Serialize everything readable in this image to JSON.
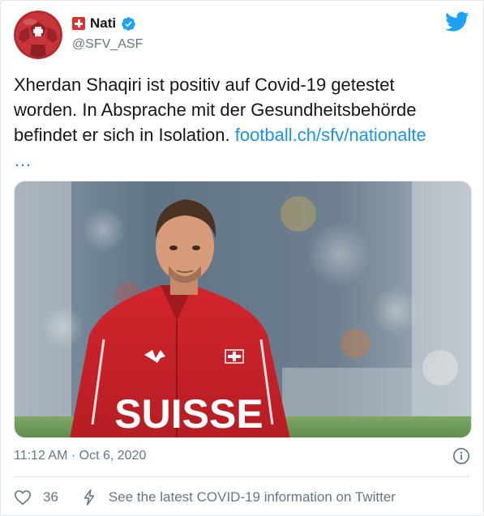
{
  "account": {
    "display_name": "Nati",
    "handle": "@SFV_ASF"
  },
  "tweet": {
    "text_lines": [
      "Xherdan Shaqiri ist positiv auf Covid-19 getestet",
      "worden. In Absprache mit der Gesundheitsbehörde",
      "befindet er sich in Isolation. "
    ],
    "link_text": "football.ch/sfv/nationalte",
    "link_ellipsis": "…"
  },
  "media": {
    "shirt_text": "SUISSE"
  },
  "meta": {
    "time": "11:12 AM",
    "separator": " · ",
    "date": "Oct 6, 2020"
  },
  "actions": {
    "like_count": "36",
    "covid_info": "See the latest COVID-19 information on Twitter"
  },
  "colors": {
    "twitter_blue": "#1da1f2",
    "link_blue": "#1b95e0",
    "secondary_text": "#657786",
    "swiss_red": "#e0302f"
  }
}
